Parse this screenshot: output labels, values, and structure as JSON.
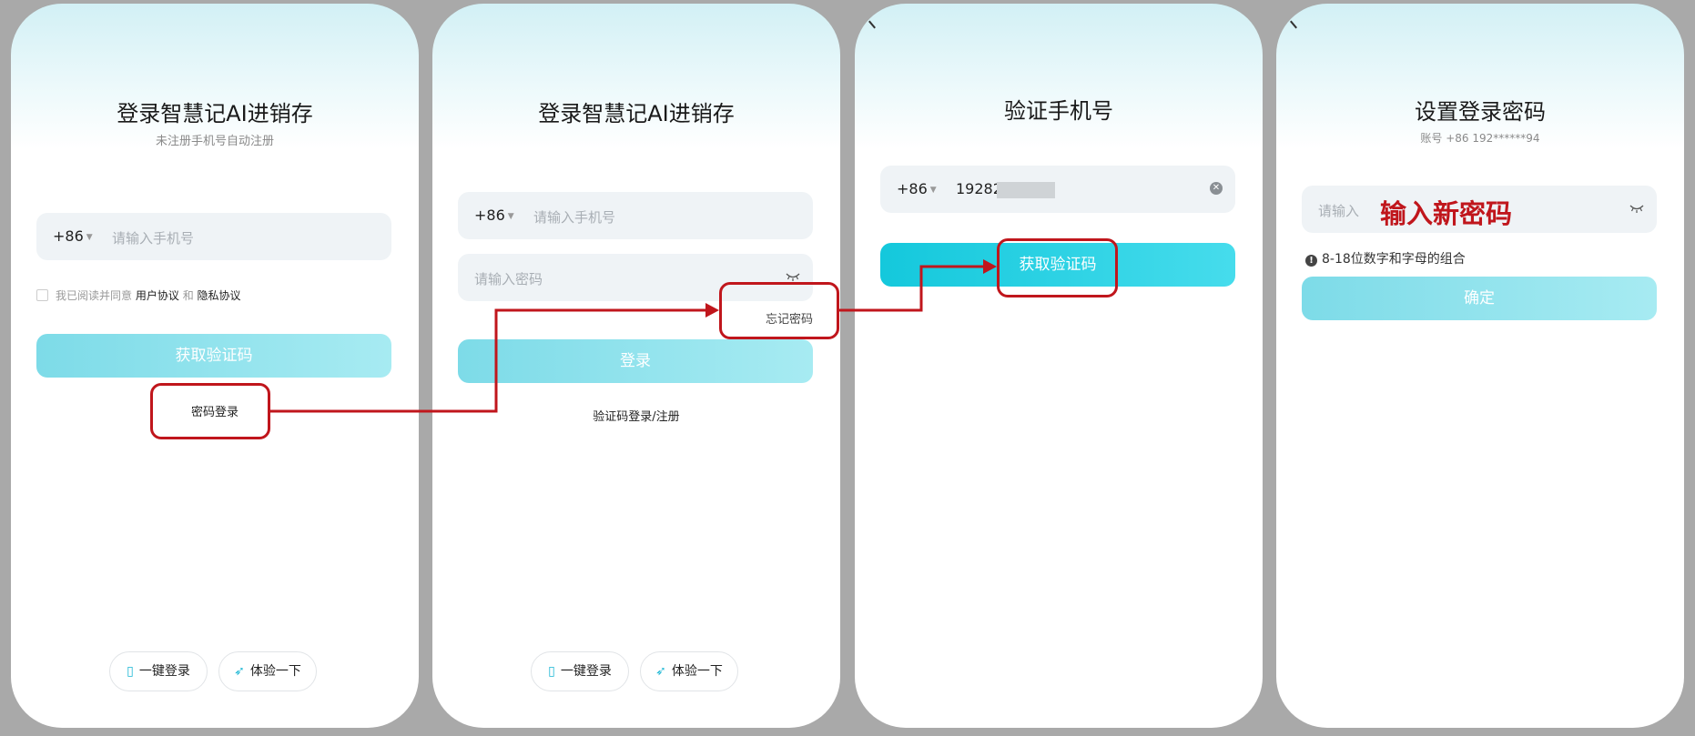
{
  "colors": {
    "accent": "#19c7dc",
    "annotation": "#c0161c"
  },
  "screen1": {
    "title": "登录智慧记AI进销存",
    "subtitle": "未注册手机号自动注册",
    "country_code": "+86",
    "phone_placeholder": "请输入手机号",
    "agree_prefix": "我已阅读并同意",
    "user_agreement": "用户协议",
    "and": "和",
    "privacy_policy": "隐私协议",
    "get_code_button": "获取验证码",
    "password_login_link": "密码登录",
    "one_click_login": "一键登录",
    "try_it": "体验一下"
  },
  "screen2": {
    "title": "登录智慧记AI进销存",
    "country_code": "+86",
    "phone_placeholder": "请输入手机号",
    "password_placeholder": "请输入密码",
    "forgot_password": "忘记密码",
    "login_button": "登录",
    "code_login_register": "验证码登录/注册",
    "one_click_login": "一键登录",
    "try_it": "体验一下"
  },
  "screen3": {
    "title": "验证手机号",
    "country_code": "+86",
    "phone_value": "19282",
    "get_code_button": "获取验证码"
  },
  "screen4": {
    "title": "设置登录密码",
    "account": "账号 +86 192******94",
    "input_placeholder": "请输入",
    "annotation": "输入新密码",
    "hint": "8-18位数字和字母的组合",
    "confirm_button": "确定"
  }
}
